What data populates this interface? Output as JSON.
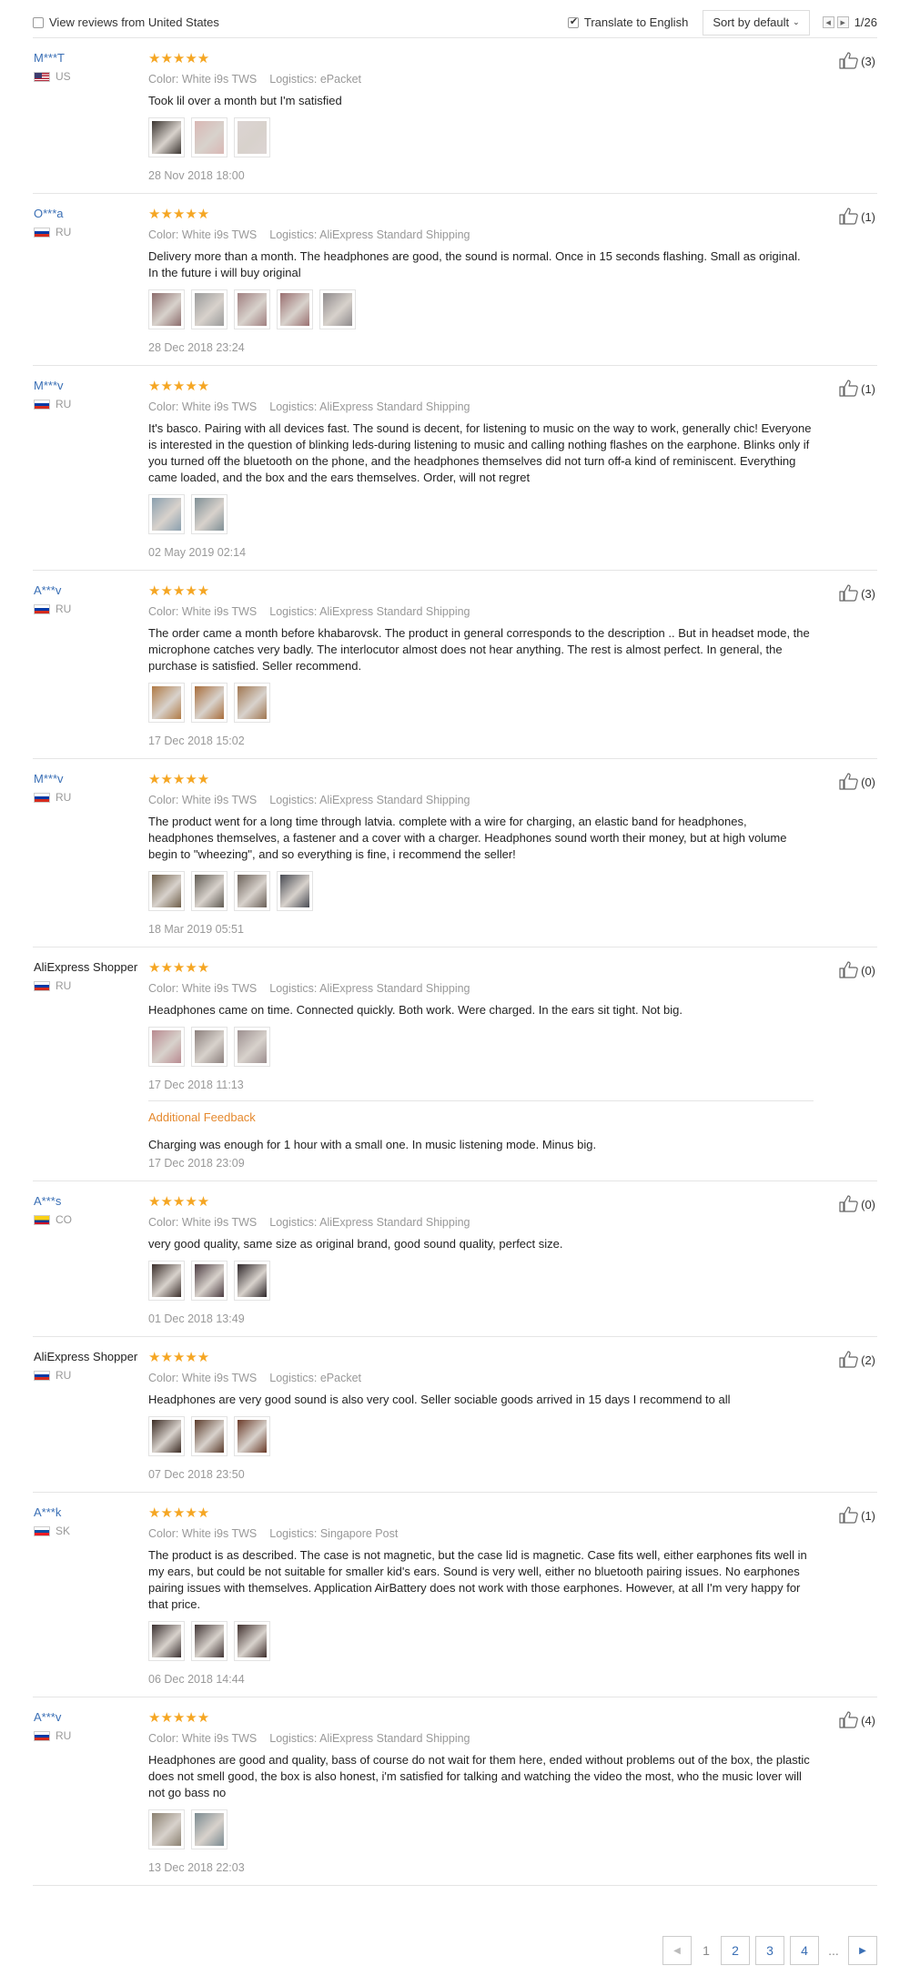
{
  "toolbar": {
    "view_from_us_label": "View reviews from United States",
    "translate_label": "Translate to English",
    "sort_label": "Sort by default",
    "page_indicator": "1/26"
  },
  "reviews": [
    {
      "name": "M***T",
      "name_style": "link",
      "flag": "us",
      "country": "US",
      "stars": "★★★★★",
      "color": "Color: White i9s TWS",
      "logistics": "Logistics: ePacket",
      "text": "Took lil over a month but I'm satisfied",
      "photos": [
        "#3a3430",
        "#d9b7b4",
        "#dcd4d3"
      ],
      "date": "28 Nov 2018 18:00",
      "likes": "(3)"
    },
    {
      "name": "O***a",
      "name_style": "link",
      "flag": "ru",
      "country": "RU",
      "stars": "★★★★★",
      "color": "Color: White i9s TWS",
      "logistics": "Logistics: AliExpress Standard Shipping",
      "text": "Delivery more than a month. The headphones are good, the sound is normal. Once in 15 seconds flashing. Small as original. In the future i will buy original",
      "photos": [
        "#8c6c6c",
        "#9a9a9a",
        "#a07f80",
        "#9a6f70",
        "#8e8a8c"
      ],
      "date": "28 Dec 2018 23:24",
      "likes": "(1)"
    },
    {
      "name": "M***v",
      "name_style": "link",
      "flag": "ru",
      "country": "RU",
      "stars": "★★★★★",
      "color": "Color: White i9s TWS",
      "logistics": "Logistics: AliExpress Standard Shipping",
      "text": "It's basco. Pairing with all devices fast. The sound is decent, for listening to music on the way to work, generally chic! Everyone is interested in the question of blinking leds-during listening to music and calling nothing flashes on the earphone. Blinks only if you turned off the bluetooth on the phone, and the headphones themselves did not turn off-a kind of reminiscent. Everything came loaded, and the box and the ears themselves. Order, will not regret",
      "photos": [
        "#8a9fae",
        "#7f8f95"
      ],
      "date": "02 May 2019 02:14",
      "likes": "(1)"
    },
    {
      "name": "A***v",
      "name_style": "link",
      "flag": "ru",
      "country": "RU",
      "stars": "★★★★★",
      "color": "Color: White i9s TWS",
      "logistics": "Logistics: AliExpress Standard Shipping",
      "text": "The order came a month before khabarovsk. The product in general corresponds to the description .. But in headset mode, the microphone catches very badly. The interlocutor almost does not hear anything. The rest is almost perfect. In general, the purchase is satisfied. Seller recommend.",
      "photos": [
        "#b07a45",
        "#a86c3a",
        "#a07650"
      ],
      "date": "17 Dec 2018 15:02",
      "likes": "(3)"
    },
    {
      "name": "M***v",
      "name_style": "link",
      "flag": "ru",
      "country": "RU",
      "stars": "★★★★★",
      "color": "Color: White i9s TWS",
      "logistics": "Logistics: AliExpress Standard Shipping",
      "text": "The product went for a long time through latvia. complete with a wire for charging, an elastic band for headphones, headphones themselves, a fastener and a cover with a charger. Headphones sound worth their money, but at high volume begin to \"wheezing\", and so everything is fine, i recommend the seller!",
      "photos": [
        "#6d5d48",
        "#5f5a52",
        "#6a6058",
        "#474a52"
      ],
      "date": "18 Mar 2019 05:51",
      "likes": "(0)"
    },
    {
      "name": "AliExpress Shopper",
      "name_style": "plain",
      "flag": "ru",
      "country": "RU",
      "stars": "★★★★★",
      "color": "Color: White i9s TWS",
      "logistics": "Logistics: AliExpress Standard Shipping",
      "text": "Headphones came on time. Connected quickly. Both work. Were charged. In the ears sit tight. Not big.",
      "photos": [
        "#b88a90",
        "#8b7f7c",
        "#9c8f8f"
      ],
      "date": "17 Dec 2018 11:13",
      "likes": "(0)",
      "additional": {
        "title": "Additional Feedback",
        "text": "Charging was enough for 1 hour with a small one. In music listening mode. Minus big.",
        "date": "17 Dec 2018 23:09"
      }
    },
    {
      "name": "A***s",
      "name_style": "link",
      "flag": "co",
      "country": "CO",
      "stars": "★★★★★",
      "color": "Color: White i9s TWS",
      "logistics": "Logistics: AliExpress Standard Shipping",
      "text": "very good quality, same size as original brand, good sound quality, perfect size.",
      "photos": [
        "#3a2e2a",
        "#4a3a40",
        "#2c2528"
      ],
      "date": "01 Dec 2018 13:49",
      "likes": "(0)"
    },
    {
      "name": "AliExpress Shopper",
      "name_style": "plain",
      "flag": "ru",
      "country": "RU",
      "stars": "★★★★★",
      "color": "Color: White i9s TWS",
      "logistics": "Logistics: ePacket",
      "text": "Headphones are very good sound is also very cool. Seller sociable goods arrived in 15 days I recommend to all",
      "photos": [
        "#3a2a22",
        "#5a3a2a",
        "#6a3a28"
      ],
      "date": "07 Dec 2018 23:50",
      "likes": "(2)"
    },
    {
      "name": "A***k",
      "name_style": "link",
      "flag": "sk",
      "country": "SK",
      "stars": "★★★★★",
      "color": "Color: White i9s TWS",
      "logistics": "Logistics: Singapore Post",
      "text": "The product is as described. The case is not magnetic, but the case lid is magnetic. Case fits well, either earphones fits well in my ears, but could be not suitable for smaller kid's ears. Sound is very well, either no bluetooth pairing issues. No earphones pairing issues with themselves. Application AirBattery does not work with those earphones. However, at all I'm very happy for that price.",
      "photos": [
        "#3a3030",
        "#403434",
        "#3e2e2c"
      ],
      "date": "06 Dec 2018 14:44",
      "likes": "(1)"
    },
    {
      "name": "A***v",
      "name_style": "link",
      "flag": "ru",
      "country": "RU",
      "stars": "★★★★★",
      "color": "Color: White i9s TWS",
      "logistics": "Logistics: AliExpress Standard Shipping",
      "text": "Headphones are good and quality, bass of course do not wait for them here, ended without problems out of the box, the plastic does not smell good, the box is also honest, i'm satisfied for talking and watching the video the most, who the music lover will not go bass no",
      "photos": [
        "#8a8070",
        "#7a8a90"
      ],
      "date": "13 Dec 2018 22:03",
      "likes": "(4)"
    }
  ],
  "pagination": {
    "prev": "◀",
    "current": "1",
    "pages": [
      "2",
      "3",
      "4"
    ],
    "ellipsis": "...",
    "next": "▶"
  }
}
